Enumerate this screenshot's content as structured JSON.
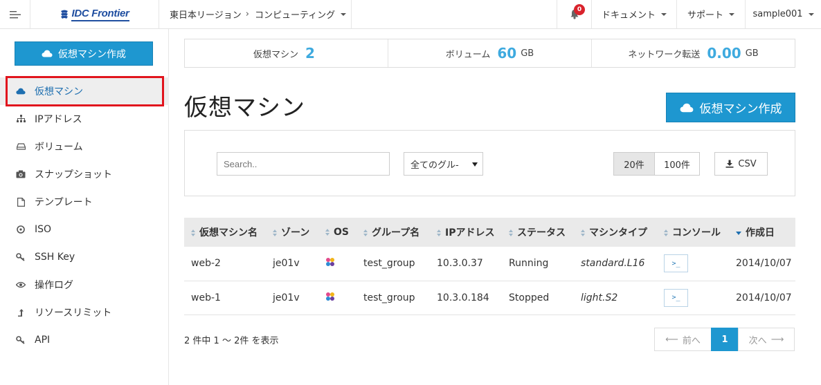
{
  "header": {
    "logo_text": "IDC Frontier",
    "region": "東日本リージョン",
    "breadcrumb_sep": "›",
    "service": "コンピューティング",
    "notifications": "0",
    "docs": "ドキュメント",
    "support": "サポート",
    "user": "sample001"
  },
  "sidebar": {
    "create_label": "仮想マシン作成",
    "items": [
      {
        "label": "仮想マシン",
        "icon": "cloud-icon"
      },
      {
        "label": "IPアドレス",
        "icon": "sitemap-icon"
      },
      {
        "label": "ボリューム",
        "icon": "hdd-icon"
      },
      {
        "label": "スナップショット",
        "icon": "camera-icon"
      },
      {
        "label": "テンプレート",
        "icon": "file-icon"
      },
      {
        "label": "ISO",
        "icon": "disc-icon"
      },
      {
        "label": "SSH Key",
        "icon": "key-icon"
      },
      {
        "label": "操作ログ",
        "icon": "eye-icon"
      },
      {
        "label": "リソースリミット",
        "icon": "level-up-icon"
      },
      {
        "label": "API",
        "icon": "key-icon"
      }
    ]
  },
  "stats": {
    "vm_label": "仮想マシン",
    "vm_value": "2",
    "volume_label": "ボリューム",
    "volume_value": "60",
    "volume_unit": "GB",
    "network_label": "ネットワーク転送",
    "network_value": "0.00",
    "network_unit": "GB"
  },
  "main": {
    "title": "仮想マシン",
    "create_label": "仮想マシン作成",
    "search_placeholder": "Search..",
    "group_select": "全てのグル-",
    "perpage": [
      "20件",
      "100件"
    ],
    "csv_label": "CSV"
  },
  "table": {
    "columns": [
      "仮想マシン名",
      "ゾーン",
      "OS",
      "グループ名",
      "IPアドレス",
      "ステータス",
      "マシンタイプ",
      "コンソール",
      "作成日"
    ],
    "rows": [
      {
        "name": "web-2",
        "zone": "je01v",
        "group": "test_group",
        "ip": "10.3.0.37",
        "status": "Running",
        "type": "standard.L16",
        "console": ">_",
        "created": "2014/10/07"
      },
      {
        "name": "web-1",
        "zone": "je01v",
        "group": "test_group",
        "ip": "10.3.0.184",
        "status": "Stopped",
        "type": "light.S2",
        "console": ">_",
        "created": "2014/10/07"
      }
    ]
  },
  "footer": {
    "count_text": "2 件中 1 ～ 2件 を表示",
    "prev": "前へ",
    "page": "1",
    "next": "次へ"
  },
  "colors": {
    "accent": "#1e97d0",
    "highlight": "#e1141d",
    "running": "#4a8f3f",
    "badge": "#d9232c"
  }
}
